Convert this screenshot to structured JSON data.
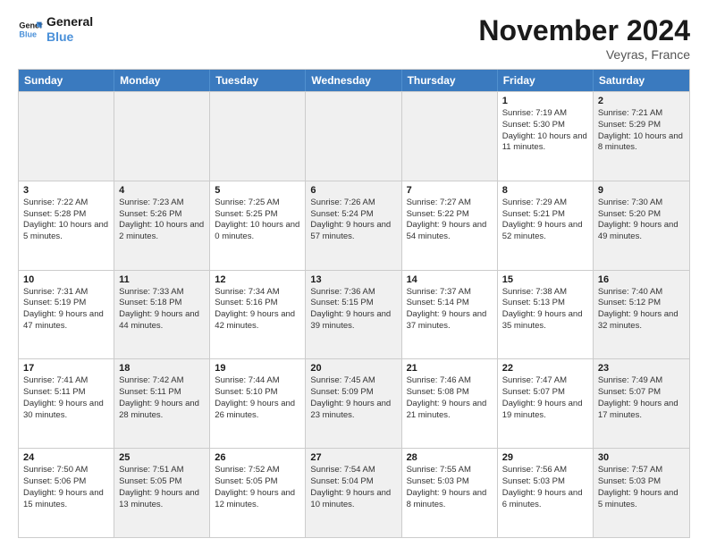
{
  "logo": {
    "line1": "General",
    "line2": "Blue"
  },
  "title": "November 2024",
  "subtitle": "Veyras, France",
  "headers": [
    "Sunday",
    "Monday",
    "Tuesday",
    "Wednesday",
    "Thursday",
    "Friday",
    "Saturday"
  ],
  "rows": [
    [
      {
        "day": "",
        "info": "",
        "shaded": true
      },
      {
        "day": "",
        "info": "",
        "shaded": true
      },
      {
        "day": "",
        "info": "",
        "shaded": true
      },
      {
        "day": "",
        "info": "",
        "shaded": true
      },
      {
        "day": "",
        "info": "",
        "shaded": true
      },
      {
        "day": "1",
        "info": "Sunrise: 7:19 AM\nSunset: 5:30 PM\nDaylight: 10 hours and 11 minutes.",
        "shaded": false
      },
      {
        "day": "2",
        "info": "Sunrise: 7:21 AM\nSunset: 5:29 PM\nDaylight: 10 hours and 8 minutes.",
        "shaded": true
      }
    ],
    [
      {
        "day": "3",
        "info": "Sunrise: 7:22 AM\nSunset: 5:28 PM\nDaylight: 10 hours and 5 minutes.",
        "shaded": false
      },
      {
        "day": "4",
        "info": "Sunrise: 7:23 AM\nSunset: 5:26 PM\nDaylight: 10 hours and 2 minutes.",
        "shaded": true
      },
      {
        "day": "5",
        "info": "Sunrise: 7:25 AM\nSunset: 5:25 PM\nDaylight: 10 hours and 0 minutes.",
        "shaded": false
      },
      {
        "day": "6",
        "info": "Sunrise: 7:26 AM\nSunset: 5:24 PM\nDaylight: 9 hours and 57 minutes.",
        "shaded": true
      },
      {
        "day": "7",
        "info": "Sunrise: 7:27 AM\nSunset: 5:22 PM\nDaylight: 9 hours and 54 minutes.",
        "shaded": false
      },
      {
        "day": "8",
        "info": "Sunrise: 7:29 AM\nSunset: 5:21 PM\nDaylight: 9 hours and 52 minutes.",
        "shaded": false
      },
      {
        "day": "9",
        "info": "Sunrise: 7:30 AM\nSunset: 5:20 PM\nDaylight: 9 hours and 49 minutes.",
        "shaded": true
      }
    ],
    [
      {
        "day": "10",
        "info": "Sunrise: 7:31 AM\nSunset: 5:19 PM\nDaylight: 9 hours and 47 minutes.",
        "shaded": false
      },
      {
        "day": "11",
        "info": "Sunrise: 7:33 AM\nSunset: 5:18 PM\nDaylight: 9 hours and 44 minutes.",
        "shaded": true
      },
      {
        "day": "12",
        "info": "Sunrise: 7:34 AM\nSunset: 5:16 PM\nDaylight: 9 hours and 42 minutes.",
        "shaded": false
      },
      {
        "day": "13",
        "info": "Sunrise: 7:36 AM\nSunset: 5:15 PM\nDaylight: 9 hours and 39 minutes.",
        "shaded": true
      },
      {
        "day": "14",
        "info": "Sunrise: 7:37 AM\nSunset: 5:14 PM\nDaylight: 9 hours and 37 minutes.",
        "shaded": false
      },
      {
        "day": "15",
        "info": "Sunrise: 7:38 AM\nSunset: 5:13 PM\nDaylight: 9 hours and 35 minutes.",
        "shaded": false
      },
      {
        "day": "16",
        "info": "Sunrise: 7:40 AM\nSunset: 5:12 PM\nDaylight: 9 hours and 32 minutes.",
        "shaded": true
      }
    ],
    [
      {
        "day": "17",
        "info": "Sunrise: 7:41 AM\nSunset: 5:11 PM\nDaylight: 9 hours and 30 minutes.",
        "shaded": false
      },
      {
        "day": "18",
        "info": "Sunrise: 7:42 AM\nSunset: 5:11 PM\nDaylight: 9 hours and 28 minutes.",
        "shaded": true
      },
      {
        "day": "19",
        "info": "Sunrise: 7:44 AM\nSunset: 5:10 PM\nDaylight: 9 hours and 26 minutes.",
        "shaded": false
      },
      {
        "day": "20",
        "info": "Sunrise: 7:45 AM\nSunset: 5:09 PM\nDaylight: 9 hours and 23 minutes.",
        "shaded": true
      },
      {
        "day": "21",
        "info": "Sunrise: 7:46 AM\nSunset: 5:08 PM\nDaylight: 9 hours and 21 minutes.",
        "shaded": false
      },
      {
        "day": "22",
        "info": "Sunrise: 7:47 AM\nSunset: 5:07 PM\nDaylight: 9 hours and 19 minutes.",
        "shaded": false
      },
      {
        "day": "23",
        "info": "Sunrise: 7:49 AM\nSunset: 5:07 PM\nDaylight: 9 hours and 17 minutes.",
        "shaded": true
      }
    ],
    [
      {
        "day": "24",
        "info": "Sunrise: 7:50 AM\nSunset: 5:06 PM\nDaylight: 9 hours and 15 minutes.",
        "shaded": false
      },
      {
        "day": "25",
        "info": "Sunrise: 7:51 AM\nSunset: 5:05 PM\nDaylight: 9 hours and 13 minutes.",
        "shaded": true
      },
      {
        "day": "26",
        "info": "Sunrise: 7:52 AM\nSunset: 5:05 PM\nDaylight: 9 hours and 12 minutes.",
        "shaded": false
      },
      {
        "day": "27",
        "info": "Sunrise: 7:54 AM\nSunset: 5:04 PM\nDaylight: 9 hours and 10 minutes.",
        "shaded": true
      },
      {
        "day": "28",
        "info": "Sunrise: 7:55 AM\nSunset: 5:03 PM\nDaylight: 9 hours and 8 minutes.",
        "shaded": false
      },
      {
        "day": "29",
        "info": "Sunrise: 7:56 AM\nSunset: 5:03 PM\nDaylight: 9 hours and 6 minutes.",
        "shaded": false
      },
      {
        "day": "30",
        "info": "Sunrise: 7:57 AM\nSunset: 5:03 PM\nDaylight: 9 hours and 5 minutes.",
        "shaded": true
      }
    ]
  ]
}
